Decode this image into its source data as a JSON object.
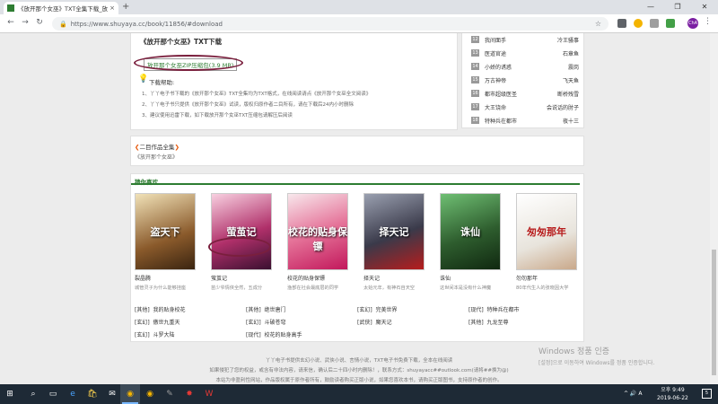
{
  "browser": {
    "tab_title": "《放开那个女巫》TXT全集下载_放",
    "tab_close": "×",
    "new_tab": "+",
    "url": "https://www.shuyaya.cc/book/11856/#download",
    "profile_initials": "ChA",
    "window_controls": [
      "—",
      "❐",
      "✕"
    ]
  },
  "download": {
    "title": "《放开那个女巫》TXT下载",
    "zip_link": "放开那个女巫ZIP压缩包(3.9 MB)",
    "help_title": "下载帮助:",
    "help_lines": [
      "1、丫丫电子书下载的《放开那个女巫》TXT全集均为TXT格式，在线阅读请点《放开那个女巫全文阅读》",
      "2、丫丫电子书只提供《放开那个女巫》试读，版权归原作者二目所有，请在下载后24内小时删除",
      "3、建议使用迅雷下载，如下载放开那个女巫TXT压缩包请解压后阅读"
    ]
  },
  "ranking": [
    {
      "num": "12",
      "name": "我间面手",
      "author": "冷王骚事"
    },
    {
      "num": "13",
      "name": "医道官途",
      "author": "石章鱼"
    },
    {
      "num": "14",
      "name": "小娇的诱惑",
      "author": "震岗"
    },
    {
      "num": "15",
      "name": "万古神帝",
      "author": "飞天鱼"
    },
    {
      "num": "16",
      "name": "都市超级医圣",
      "author": "断桥残雪"
    },
    {
      "num": "17",
      "name": "大王饶命",
      "author": "会说话的肘子"
    },
    {
      "num": "18",
      "name": "特种兵在都市",
      "author": "夜十三"
    }
  ],
  "second_author": {
    "title": "二目作品全集",
    "item": "《放开那个女巫》"
  },
  "guess": {
    "title": "猜你喜欢",
    "books": [
      {
        "name": "裂晶腾",
        "desc": "城管灵子为什么能够挂座",
        "cover_text": "盗天下",
        "color": "#8a5a2b"
      },
      {
        "name": "萤茧记",
        "desc": "苗少爷情侠全然，五成分",
        "cover_text": "萤茧记",
        "color": "#b0306a"
      },
      {
        "name": "校花的贴身保镖",
        "desc": "渔部在社会最底层的同学",
        "cover_text": "校花的贴身保镖",
        "color": "#c2185b"
      },
      {
        "name": "择天记",
        "desc": "太始元年，有神石自天空",
        "cover_text": "择天记",
        "color": "#3a3a4a"
      },
      {
        "name": "诛仙",
        "desc": "这世间本是没有什么神魔",
        "cover_text": "诛仙",
        "color": "#2e5d2e"
      },
      {
        "name": "勿勿那年",
        "desc": "80年代生人的张晓因大学",
        "cover_text": "匆匆那年",
        "color": "#e8e4dc"
      }
    ],
    "links": [
      [
        {
          "cat": "[其他]",
          "title": "我的贴身校花"
        },
        {
          "cat": "[其他]",
          "title": "绝世唐门"
        },
        {
          "cat": "[玄幻]",
          "title": "完美世界"
        },
        {
          "cat": "[现代]",
          "title": "特种兵在都市"
        }
      ],
      [
        {
          "cat": "[玄幻]",
          "title": "傲世九重天"
        },
        {
          "cat": "[玄幻]",
          "title": "斗破苍穹"
        },
        {
          "cat": "[武侠]",
          "title": "魔天记"
        },
        {
          "cat": "[其他]",
          "title": "九龙至尊"
        }
      ],
      [
        {
          "cat": "[玄幻]",
          "title": "斗罗大陆"
        },
        {
          "cat": "[现代]",
          "title": "校花的贴身高手"
        }
      ]
    ]
  },
  "footer": [
    "丫丫电子书提供玄幻小说、武侠小说、言情小说，TXT电子书免费下载，全本在线阅读",
    "如果侵犯了您的权益，或含有非法内容，请来信，确认后二十四小时内删除！，联系方式：shuyayacc##outlook.com(请将##换为@)",
    "本站为非盈利性网站，作品版权属于原作者所有，鼓励读者购买正版小说，如果您喜欢本书，请购买正版图书，支持原作者的创作。"
  ],
  "watermark": {
    "line1": "Windows 정품 인증",
    "line2": "[설정]으로 이동하여 Windows를 정품 인증합니다."
  },
  "taskbar": {
    "clock_time": "오후 9:49",
    "clock_date": "2019-06-22",
    "ime": "^ 🔊 A",
    "notif_count": "5"
  },
  "colors": {
    "accent_green": "#2e7d32",
    "annotation_circle": "#7a1f3d",
    "taskbar_bg": "#1e2a36"
  }
}
